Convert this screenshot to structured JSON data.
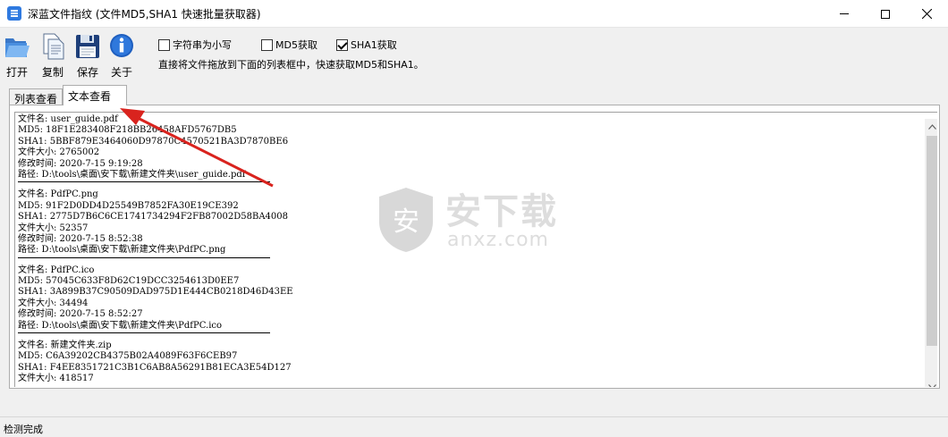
{
  "window": {
    "title": "深蓝文件指纹 (文件MD5,SHA1 快速批量获取器)"
  },
  "toolbar": {
    "open_label": "打开",
    "copy_label": "复制",
    "save_label": "保存",
    "about_label": "关于"
  },
  "options": {
    "lowercase": {
      "label": "字符串为小写",
      "checked": false
    },
    "md5": {
      "label": "MD5获取",
      "checked": false
    },
    "sha1": {
      "label": "SHA1获取",
      "checked": true
    }
  },
  "hint": "直接将文件拖放到下面的列表框中，快速获取MD5和SHA1。",
  "tabs": [
    {
      "label": "列表查看",
      "active": false
    },
    {
      "label": "文本查看",
      "active": true
    }
  ],
  "files": [
    {
      "name_line": "文件名: user_guide.pdf",
      "md5_line": "MD5: 18F1E283408F218BB26458AFD5767DB5",
      "sha1_line": "SHA1: 5BBF879E3464060D97870C4570521BA3D7870BE6",
      "size_line": "文件大小: 2765002",
      "mtime_line": "修改时间: 2020-7-15 9:19:28",
      "path_line": "路径: D:\\tools\\桌面\\安下载\\新建文件夹\\user_guide.pdf"
    },
    {
      "name_line": "文件名: PdfPC.png",
      "md5_line": "MD5: 91F2D0DD4D25549B7852FA30E19CE392",
      "sha1_line": "SHA1: 2775D7B6C6CE1741734294F2FB87002D58BA4008",
      "size_line": "文件大小: 52357",
      "mtime_line": "修改时间: 2020-7-15 8:52:38",
      "path_line": "路径: D:\\tools\\桌面\\安下载\\新建文件夹\\PdfPC.png"
    },
    {
      "name_line": "文件名: PdfPC.ico",
      "md5_line": "MD5: 57045C633F8D62C19DCC3254613D0EE7",
      "sha1_line": "SHA1: 3A899B37C90509DAD975D1E444CB0218D46D43EE",
      "size_line": "文件大小: 34494",
      "mtime_line": "修改时间: 2020-7-15 8:52:27",
      "path_line": "路径: D:\\tools\\桌面\\安下载\\新建文件夹\\PdfPC.ico"
    },
    {
      "name_line": "文件名: 新建文件夹.zip",
      "md5_line": "MD5: C6A39202CB4375B02A4089F63F6CEB97",
      "sha1_line": "SHA1: F4EE8351721C3B1C6AB8A56291B81ECA3E54D127",
      "size_line": "文件大小: 418517"
    }
  ],
  "watermark": {
    "brand": "安下载",
    "domain": "anxz.com",
    "shield_char": "安"
  },
  "status": {
    "text": "检测完成"
  },
  "colors": {
    "app_icon": "#2f7ae0",
    "annotation_arrow": "#d9231e",
    "about_icon": "#1f5fbf",
    "save_icon": "#1e3f7a"
  },
  "icons": {
    "open": "folder-open-icon",
    "copy": "copy-documents-icon",
    "save": "floppy-disk-icon",
    "about": "info-icon"
  }
}
